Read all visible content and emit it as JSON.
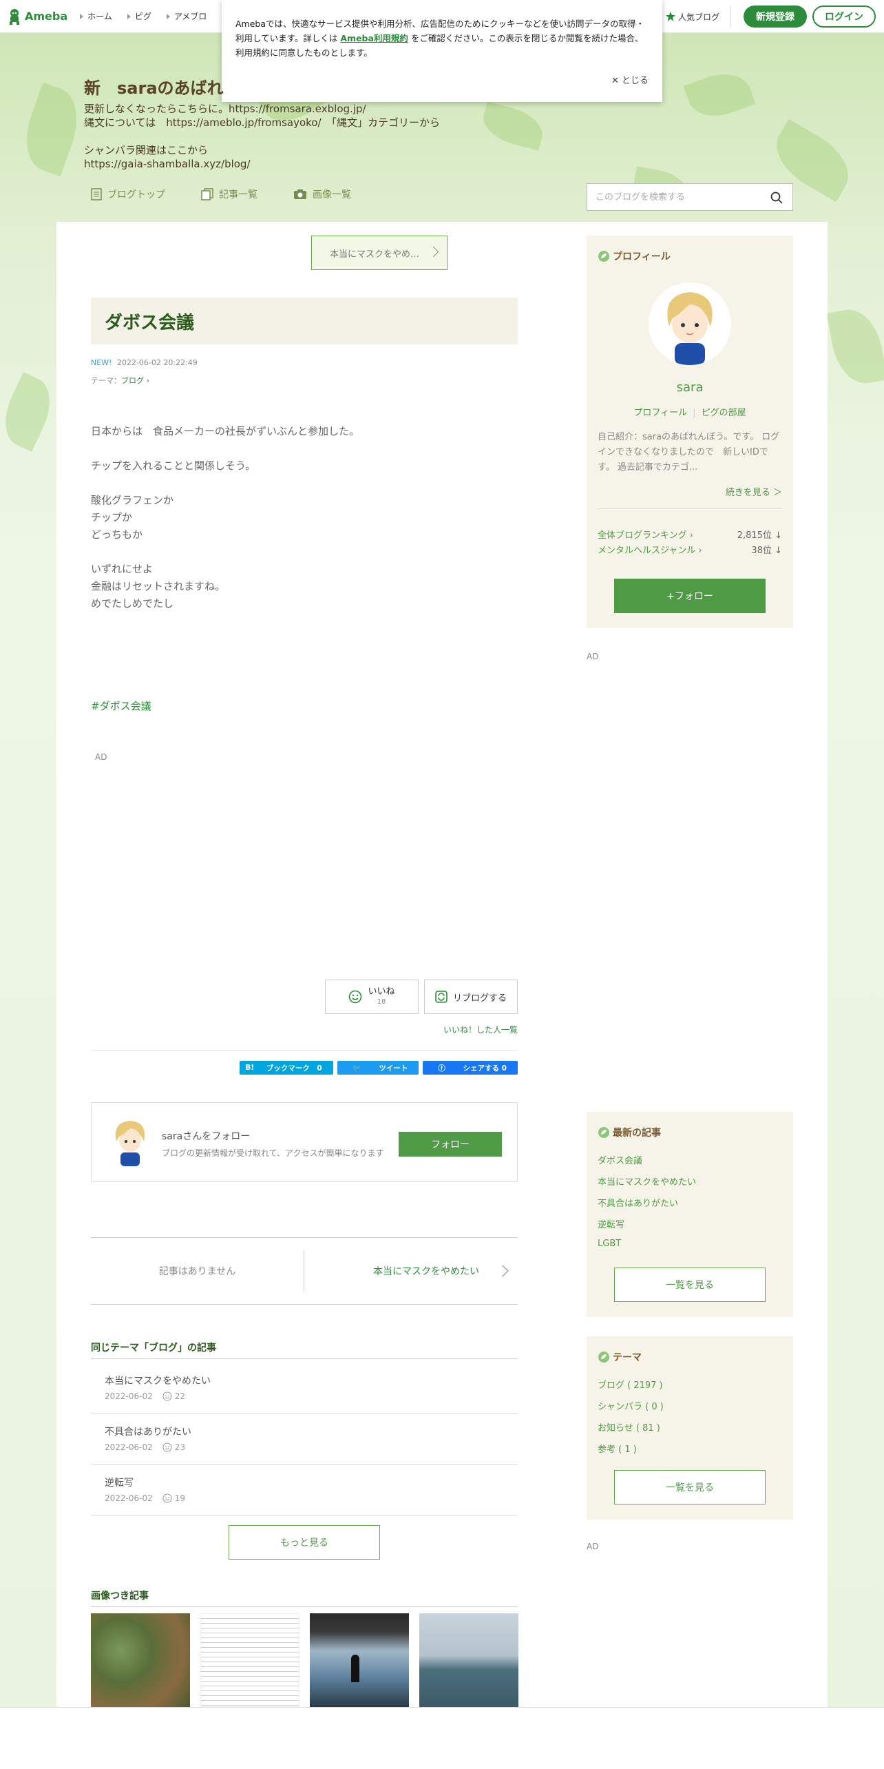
{
  "header": {
    "logo_text": "Ameba",
    "nav": [
      "ホーム",
      "ピグ",
      "アメブロ"
    ],
    "popular_blog": "人気ブログ",
    "register": "新規登録",
    "login": "ログイン"
  },
  "cookie": {
    "text_before": "Amebaでは、快適なサービス提供や利用分析、広告配信のためにクッキーなどを使い訪問データの取得・利用しています。詳しくは",
    "link": "Ameba利用規約",
    "text_after": "をご確認ください。この表示を閉じるか閲覧を続けた場合、利用規約に同意したものとします。",
    "close": "とじる"
  },
  "blog": {
    "title": "新　saraのあばれ",
    "description": "更新しなくなったらこちらに。https://fromsara.exblog.jp/\n縄文については　https://ameblo.jp/fromsayoko/　「縄文」カテゴリーから\n\nシャンバラ関連はここから\nhttps://gaia-shamballa.xyz/blog/",
    "nav": [
      "ブログトップ",
      "記事一覧",
      "画像一覧"
    ],
    "search_placeholder": "このブログを検索する"
  },
  "entry": {
    "prev_button": "本当にマスクをやめ…",
    "title": "ダボス会議",
    "new_label": "NEW!",
    "datetime": "2022-06-02 20:22:49",
    "theme_prefix": "テーマ：",
    "theme": "ブログ",
    "body": [
      "日本からは　食品メーカーの社長がずいぶんと参加した。",
      "",
      "チップを入れることと関係しそう。",
      "",
      "酸化グラフェンか",
      "チップか",
      "どっちもか",
      "",
      "いずれにせよ",
      "金融はリセットされますね。",
      "めでたしめでたし"
    ],
    "hashtag": "#ダボス会議",
    "ad": "AD",
    "iine_label": "いいね",
    "iine_count": "18",
    "reblog_label": "リブログする",
    "iine_list": "いいね！した人一覧",
    "share": [
      "ブックマーク　0",
      "ツイート",
      "シェアする 0"
    ]
  },
  "follow_box": {
    "title": "saraさんをフォロー",
    "sub": "ブログの更新情報が受け取れて、アクセスが簡単になります",
    "button": "フォロー"
  },
  "pager": {
    "prev": "記事はありません",
    "next": "本当にマスクをやめたい"
  },
  "same_theme": {
    "title": "同じテーマ「ブログ」の記事",
    "items": [
      {
        "title": "本当にマスクをやめたい",
        "date": "2022-06-02",
        "count": "22"
      },
      {
        "title": "不具合はありがたい",
        "date": "2022-06-02",
        "count": "23"
      },
      {
        "title": "逆転写",
        "date": "2022-06-02",
        "count": "19"
      }
    ],
    "more": "もっと見る"
  },
  "image_articles": {
    "title": "画像つき記事"
  },
  "sidebar": {
    "profile": {
      "head": "プロフィール",
      "name": "sara",
      "link1": "プロフィール",
      "link2": "ピグの部屋",
      "intro": "自己紹介：saraのあばれんぼう。です。 ログインできなくなりましたので　新しいIDです。 過去記事でカテゴ...",
      "more": "続きを見る ＞",
      "ranking_all_label": "全体ブログランキング",
      "ranking_all_value": "2,815位 ↓",
      "ranking_genre_label": "メンタルヘルスジャンル",
      "ranking_genre_value": "38位 ↓",
      "follow": "+フォロー"
    },
    "ad": "AD",
    "recent": {
      "head": "最新の記事",
      "items": [
        "ダボス会議",
        "本当にマスクをやめたい",
        "不具合はありがたい",
        "逆転写",
        "LGBT"
      ],
      "button": "一覧を見る"
    },
    "theme": {
      "head": "テーマ",
      "items": [
        "ブログ ( 2197 )",
        "シャンバラ ( 0 )",
        "お知らせ ( 81 )",
        "参考 ( 1 )"
      ],
      "button": "一覧を見る"
    }
  },
  "colors": {
    "accent": "#2d8c3c",
    "title_green": "#2b5b1c",
    "sidebar_bg": "#f6f3e8"
  }
}
